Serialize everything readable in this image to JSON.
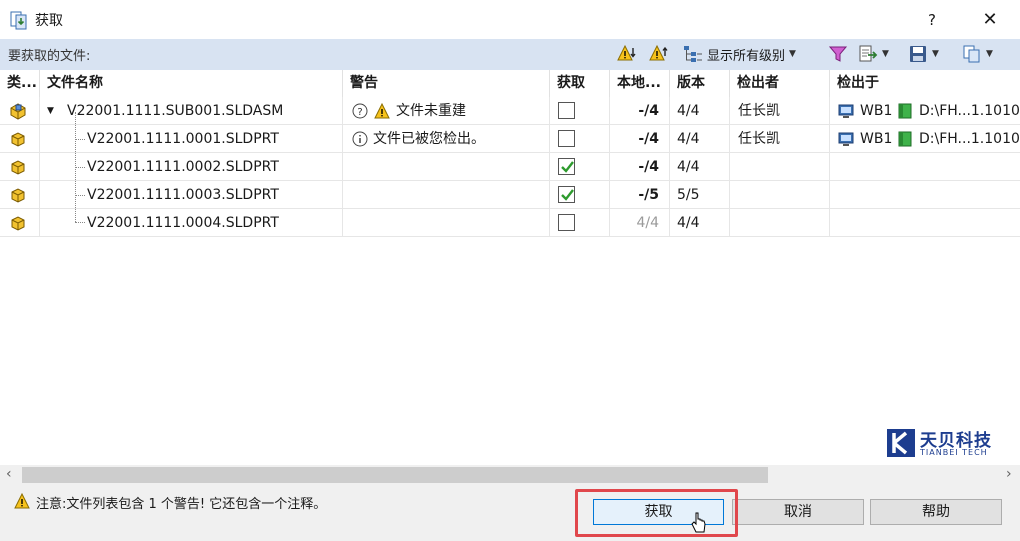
{
  "window": {
    "title": "获取",
    "help": "?",
    "close": "✕"
  },
  "toolbar": {
    "label": "要获取的文件:",
    "show_levels": "显示所有级别"
  },
  "table": {
    "headers": [
      "类...",
      "文件名称",
      "警告",
      "获取",
      "本地...",
      "版本",
      "检出者",
      "检出于"
    ],
    "rows": [
      {
        "name": "V22001.1111.SUB001.SLDASM",
        "warning": "文件未重建",
        "get": false,
        "local": "-/4",
        "version": "4/4",
        "checked_out_by": "任长凯",
        "wb": "WB1",
        "path": "D:\\FH...1.1010"
      },
      {
        "name": "V22001.1111.0001.SLDPRT",
        "warning": "文件已被您检出。",
        "get": false,
        "local": "-/4",
        "version": "4/4",
        "checked_out_by": "任长凯",
        "wb": "WB1",
        "path": "D:\\FH...1.1010"
      },
      {
        "name": "V22001.1111.0002.SLDPRT",
        "warning": "",
        "get": true,
        "local": "-/4",
        "version": "4/4",
        "checked_out_by": "",
        "wb": "",
        "path": ""
      },
      {
        "name": "V22001.1111.0003.SLDPRT",
        "warning": "",
        "get": true,
        "local": "-/5",
        "version": "5/5",
        "checked_out_by": "",
        "wb": "",
        "path": ""
      },
      {
        "name": "V22001.1111.0004.SLDPRT",
        "warning": "",
        "get": false,
        "local": "4/4",
        "version": "4/4",
        "checked_out_by": "",
        "wb": "",
        "path": ""
      }
    ]
  },
  "footer": {
    "note": "注意:文件列表包含 1 个警告! 它还包含一个注释。",
    "get_button": "获取",
    "cancel_button": "取消",
    "help_button": "帮助"
  },
  "logo": {
    "cn": "天贝科技",
    "en": "TIANBEI TECH"
  },
  "colors": {
    "toolbar_bg": "#d8e3f2",
    "highlight": "#e0474c",
    "check": "#2e9b2e",
    "logo": "#1d3d8f"
  }
}
